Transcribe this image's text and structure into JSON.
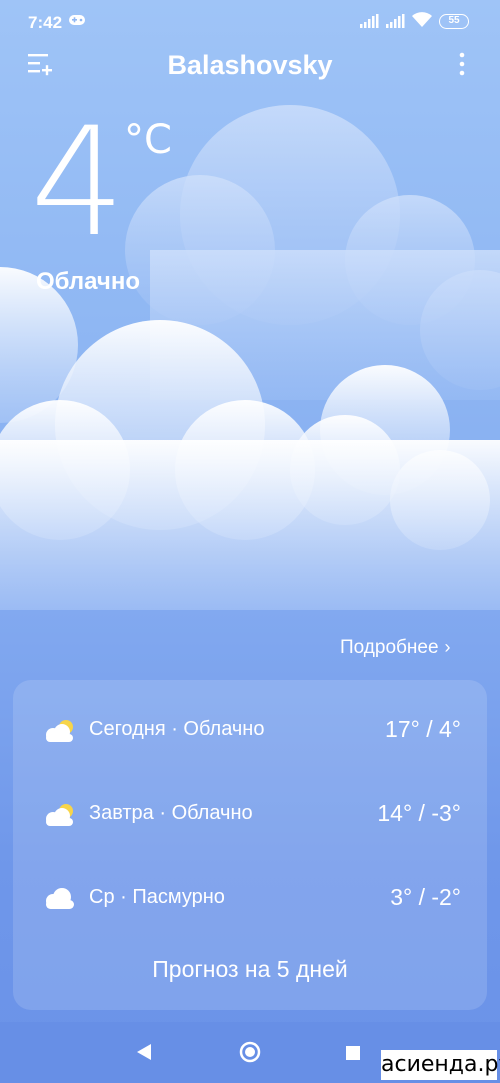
{
  "status_bar": {
    "time": "7:42",
    "battery": "55",
    "icons": [
      "gamepad-icon",
      "signal-icon",
      "signal-icon",
      "wifi-icon",
      "battery-icon"
    ]
  },
  "header": {
    "city": "Balashovsky",
    "menu_icon": "add-city-menu-icon",
    "more_icon": "more-vertical-icon"
  },
  "current": {
    "temperature": "4",
    "unit": "°C",
    "condition": "Облачно"
  },
  "details_link": {
    "label": "Подробнее",
    "icon": "chevron-right-icon"
  },
  "forecast": {
    "rows": [
      {
        "label": "Сегодня · Облачно",
        "temps": "17° / 4°",
        "icon": "partly-cloudy-icon"
      },
      {
        "label": "Завтра · Облачно",
        "temps": "14° / -3°",
        "icon": "partly-cloudy-icon"
      },
      {
        "label": "Ср · Пасмурно",
        "temps": "3° / -2°",
        "icon": "cloud-icon"
      }
    ],
    "button_label": "Прогноз на 5 дней"
  },
  "watermark": "асиенда.ру",
  "colors": {
    "sky_top": "#9fc4f7",
    "sky_bottom": "#6a92e8",
    "sun": "#f7d54a"
  }
}
